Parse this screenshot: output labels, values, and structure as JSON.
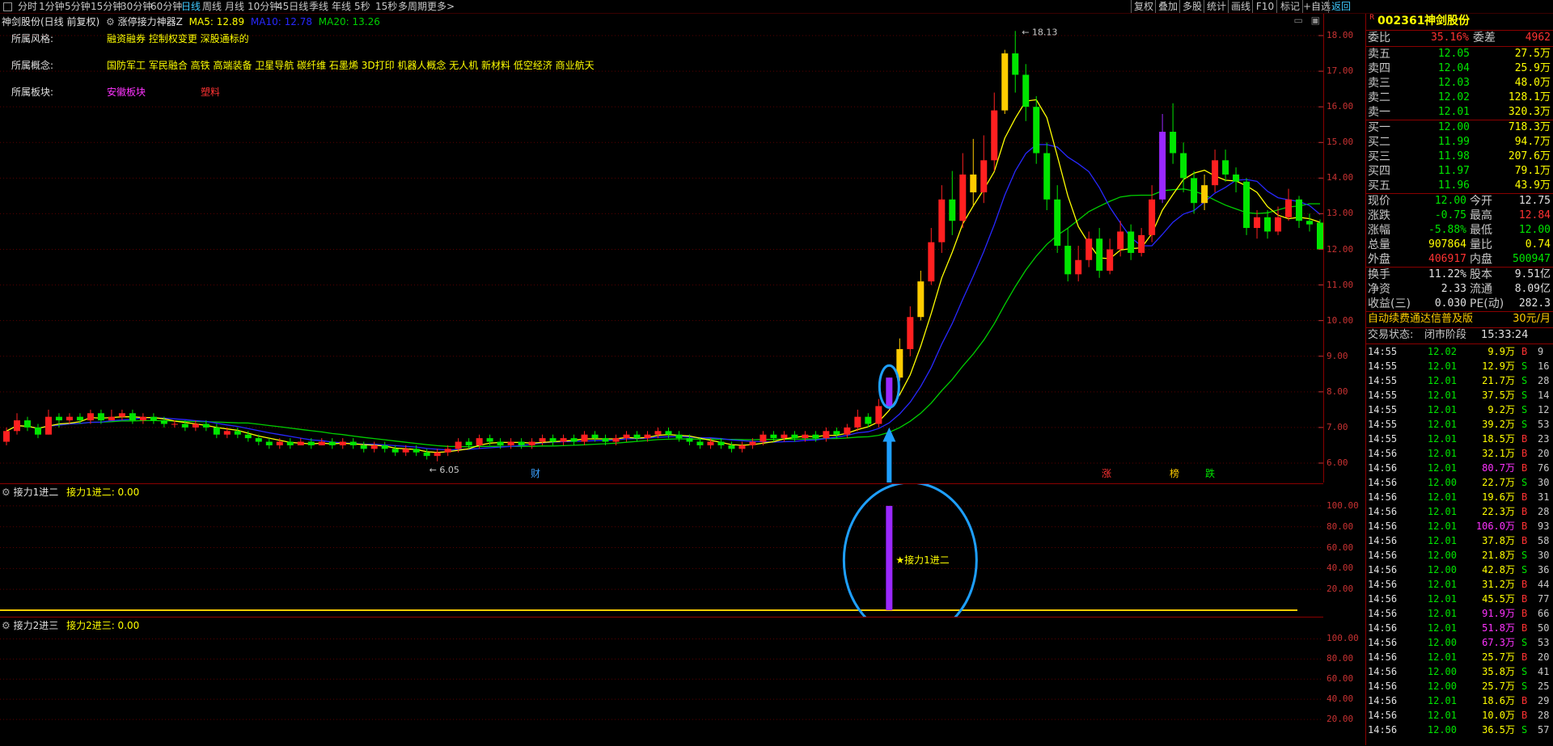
{
  "topbar": {
    "periods": [
      "分时",
      "1分钟",
      "5分钟",
      "15分钟",
      "30分钟",
      "60分钟",
      "日线",
      "周线",
      "月线",
      "10分钟",
      "45日线",
      "季线",
      "年线",
      "5秒",
      "15秒",
      "多周期",
      "更多>"
    ],
    "active_period": "日线",
    "tools": [
      "复权",
      "叠加",
      "多股",
      "统计",
      "画线",
      "F10",
      "标记",
      "+自选",
      "返回"
    ]
  },
  "chart_header": {
    "stock": "神剑股份(日线 前复权)",
    "indicator": "涨停接力神器Z",
    "ma5": "MA5: 12.89",
    "ma10": "MA10: 12.78",
    "ma20": "MA20: 13.26",
    "colors": {
      "ma5": "#ffff00",
      "ma10": "#2828ff",
      "ma20": "#00d000"
    }
  },
  "info": [
    {
      "label": "所属风格:",
      "value": "融资融券 控制权变更 深股通标的",
      "color": "#ffff00"
    },
    {
      "label": "所属概念:",
      "value": "国防军工 军民融合 高铁 高端装备 卫星导航 碳纤维 石墨烯 3D打印 机器人概念 无人机 新材料 低空经济 商业航天",
      "color": "#ffff00"
    },
    {
      "label": "所属板块:",
      "value": "安徽板块",
      "value2": "塑料",
      "color": "#ff33ff",
      "color2": "#ff3333"
    }
  ],
  "y_axis_main": [
    "18.00",
    "17.00",
    "16.00",
    "15.00",
    "14.00",
    "13.00",
    "12.00",
    "11.00",
    "10.00",
    "9.00",
    "8.00",
    "7.00",
    "6.00"
  ],
  "markers": {
    "high": "18.13",
    "low": "6.05",
    "cai": "财",
    "zhang": "涨",
    "bang": "榜",
    "die": "跌"
  },
  "indicator1": {
    "title": "接力1进二",
    "value_label": "接力1进二: 0.00",
    "signal_label": "★接力1进二",
    "y_axis": [
      "100.00",
      "80.00",
      "60.00",
      "40.00",
      "20.00"
    ]
  },
  "indicator2": {
    "title": "接力2进三",
    "value_label": "接力2进三: 0.00",
    "y_axis": [
      "100.00",
      "80.00",
      "60.00",
      "40.00",
      "20.00"
    ]
  },
  "quote": {
    "code": "002361",
    "name": "神剑股份",
    "weibi_label": "委比",
    "weibi": "35.16%",
    "weicha_label": "委差",
    "weicha": "4962",
    "asks": [
      {
        "label": "卖五",
        "price": "12.05",
        "vol": "27.5万"
      },
      {
        "label": "卖四",
        "price": "12.04",
        "vol": "25.9万"
      },
      {
        "label": "卖三",
        "price": "12.03",
        "vol": "48.0万"
      },
      {
        "label": "卖二",
        "price": "12.02",
        "vol": "128.1万"
      },
      {
        "label": "卖一",
        "price": "12.01",
        "vol": "320.3万"
      }
    ],
    "bids": [
      {
        "label": "买一",
        "price": "12.00",
        "vol": "718.3万"
      },
      {
        "label": "买二",
        "price": "11.99",
        "vol": "94.7万"
      },
      {
        "label": "买三",
        "price": "11.98",
        "vol": "207.6万"
      },
      {
        "label": "买四",
        "price": "11.97",
        "vol": "79.1万"
      },
      {
        "label": "买五",
        "price": "11.96",
        "vol": "43.9万"
      }
    ],
    "stats": [
      {
        "l1": "现价",
        "v1": "12.00",
        "c1": "#00e600",
        "l2": "今开",
        "v2": "12.75",
        "c2": "#e0e0e0"
      },
      {
        "l1": "涨跌",
        "v1": "-0.75",
        "c1": "#00e600",
        "l2": "最高",
        "v2": "12.84",
        "c2": "#ff3232"
      },
      {
        "l1": "涨幅",
        "v1": "-5.88%",
        "c1": "#00e600",
        "l2": "最低",
        "v2": "12.00",
        "c2": "#00e600"
      },
      {
        "l1": "总量",
        "v1": "907864",
        "c1": "#ffff00",
        "l2": "量比",
        "v2": "0.74",
        "c2": "#ffff00"
      },
      {
        "l1": "外盘",
        "v1": "406917",
        "c1": "#ff3232",
        "l2": "内盘",
        "v2": "500947",
        "c2": "#00e600"
      }
    ],
    "stats2": [
      {
        "l1": "换手",
        "v1": "11.22%",
        "l2": "股本",
        "v2": "9.51亿"
      },
      {
        "l1": "净资",
        "v1": "2.33",
        "l2": "流通",
        "v2": "8.09亿"
      },
      {
        "l1": "收益(三)",
        "v1": "0.030",
        "l2": "PE(动)",
        "v2": "282.3"
      }
    ],
    "ad": "自动续费通达信普及版",
    "ad_price": "30元/月",
    "trade_status_label": "交易状态:",
    "trade_status": "闭市阶段",
    "trade_time": "15:33:24",
    "ticks": [
      {
        "t": "14:55",
        "p": "12.02",
        "v": "9.9万",
        "bs": "B",
        "n": "9"
      },
      {
        "t": "14:55",
        "p": "12.01",
        "v": "12.9万",
        "bs": "S",
        "n": "16"
      },
      {
        "t": "14:55",
        "p": "12.01",
        "v": "21.7万",
        "bs": "S",
        "n": "28"
      },
      {
        "t": "14:55",
        "p": "12.01",
        "v": "37.5万",
        "bs": "S",
        "n": "14"
      },
      {
        "t": "14:55",
        "p": "12.01",
        "v": "9.2万",
        "bs": "S",
        "n": "12"
      },
      {
        "t": "14:55",
        "p": "12.01",
        "v": "39.2万",
        "bs": "S",
        "n": "53"
      },
      {
        "t": "14:55",
        "p": "12.01",
        "v": "18.5万",
        "bs": "B",
        "n": "23"
      },
      {
        "t": "14:56",
        "p": "12.01",
        "v": "32.1万",
        "bs": "B",
        "n": "20"
      },
      {
        "t": "14:56",
        "p": "12.01",
        "v": "80.7万",
        "bs": "B",
        "n": "76"
      },
      {
        "t": "14:56",
        "p": "12.00",
        "v": "22.7万",
        "bs": "S",
        "n": "30"
      },
      {
        "t": "14:56",
        "p": "12.01",
        "v": "19.6万",
        "bs": "B",
        "n": "31"
      },
      {
        "t": "14:56",
        "p": "12.01",
        "v": "22.3万",
        "bs": "B",
        "n": "28"
      },
      {
        "t": "14:56",
        "p": "12.01",
        "v": "106.0万",
        "bs": "B",
        "n": "93"
      },
      {
        "t": "14:56",
        "p": "12.01",
        "v": "37.8万",
        "bs": "B",
        "n": "58"
      },
      {
        "t": "14:56",
        "p": "12.00",
        "v": "21.8万",
        "bs": "S",
        "n": "30"
      },
      {
        "t": "14:56",
        "p": "12.00",
        "v": "42.8万",
        "bs": "S",
        "n": "36"
      },
      {
        "t": "14:56",
        "p": "12.01",
        "v": "31.2万",
        "bs": "B",
        "n": "44"
      },
      {
        "t": "14:56",
        "p": "12.01",
        "v": "45.5万",
        "bs": "B",
        "n": "77"
      },
      {
        "t": "14:56",
        "p": "12.01",
        "v": "91.9万",
        "bs": "B",
        "n": "66"
      },
      {
        "t": "14:56",
        "p": "12.01",
        "v": "51.8万",
        "bs": "B",
        "n": "50"
      },
      {
        "t": "14:56",
        "p": "12.00",
        "v": "67.3万",
        "bs": "S",
        "n": "53"
      },
      {
        "t": "14:56",
        "p": "12.01",
        "v": "25.7万",
        "bs": "B",
        "n": "20"
      },
      {
        "t": "14:56",
        "p": "12.00",
        "v": "35.8万",
        "bs": "S",
        "n": "41"
      },
      {
        "t": "14:56",
        "p": "12.00",
        "v": "25.7万",
        "bs": "S",
        "n": "25"
      },
      {
        "t": "14:56",
        "p": "12.01",
        "v": "18.6万",
        "bs": "B",
        "n": "29"
      },
      {
        "t": "14:56",
        "p": "12.01",
        "v": "10.0万",
        "bs": "B",
        "n": "28"
      },
      {
        "t": "14:56",
        "p": "12.00",
        "v": "36.5万",
        "bs": "S",
        "n": "57"
      }
    ]
  },
  "chart_data": {
    "type": "candlestick",
    "ylim": [
      5.5,
      18.5
    ],
    "candles": [
      [
        6.6,
        6.9,
        7.0,
        6.5
      ],
      [
        6.9,
        7.2,
        7.4,
        6.8
      ],
      [
        7.2,
        7.0,
        7.3,
        6.9
      ],
      [
        7.0,
        6.8,
        7.1,
        6.7
      ],
      [
        6.8,
        7.3,
        7.5,
        6.8
      ],
      [
        7.3,
        7.2,
        7.4,
        7.0
      ],
      [
        7.2,
        7.3,
        7.4,
        7.1
      ],
      [
        7.3,
        7.2,
        7.4,
        7.1
      ],
      [
        7.2,
        7.4,
        7.5,
        7.1
      ],
      [
        7.4,
        7.2,
        7.5,
        7.1
      ],
      [
        7.2,
        7.3,
        7.5,
        7.2
      ],
      [
        7.3,
        7.4,
        7.5,
        7.2
      ],
      [
        7.4,
        7.2,
        7.5,
        7.1
      ],
      [
        7.2,
        7.3,
        7.4,
        7.1
      ],
      [
        7.3,
        7.2,
        7.4,
        7.1
      ],
      [
        7.2,
        7.1,
        7.3,
        7.0
      ],
      [
        7.1,
        7.1,
        7.2,
        7.0
      ],
      [
        7.1,
        7.0,
        7.2,
        6.9
      ],
      [
        7.0,
        7.1,
        7.2,
        6.9
      ],
      [
        7.1,
        7.0,
        7.2,
        6.9
      ],
      [
        7.0,
        6.8,
        7.1,
        6.7
      ],
      [
        6.8,
        6.9,
        7.0,
        6.7
      ],
      [
        6.9,
        6.8,
        7.0,
        6.7
      ],
      [
        6.8,
        6.7,
        6.9,
        6.6
      ],
      [
        6.7,
        6.6,
        6.8,
        6.5
      ],
      [
        6.6,
        6.5,
        6.7,
        6.4
      ],
      [
        6.5,
        6.6,
        6.7,
        6.4
      ],
      [
        6.6,
        6.5,
        6.7,
        6.4
      ],
      [
        6.5,
        6.6,
        6.7,
        6.5
      ],
      [
        6.6,
        6.5,
        6.7,
        6.4
      ],
      [
        6.5,
        6.6,
        6.7,
        6.5
      ],
      [
        6.6,
        6.5,
        6.7,
        6.4
      ],
      [
        6.5,
        6.6,
        6.7,
        6.4
      ],
      [
        6.6,
        6.5,
        6.7,
        6.4
      ],
      [
        6.5,
        6.4,
        6.6,
        6.3
      ],
      [
        6.4,
        6.5,
        6.6,
        6.3
      ],
      [
        6.5,
        6.4,
        6.6,
        6.3
      ],
      [
        6.4,
        6.3,
        6.5,
        6.2
      ],
      [
        6.3,
        6.4,
        6.5,
        6.2
      ],
      [
        6.4,
        6.3,
        6.5,
        6.2
      ],
      [
        6.3,
        6.2,
        6.4,
        6.1
      ],
      [
        6.2,
        6.3,
        6.4,
        6.05
      ],
      [
        6.3,
        6.4,
        6.5,
        6.2
      ],
      [
        6.4,
        6.6,
        6.7,
        6.3
      ],
      [
        6.6,
        6.5,
        6.7,
        6.4
      ],
      [
        6.5,
        6.7,
        6.8,
        6.4
      ],
      [
        6.7,
        6.6,
        6.8,
        6.5
      ],
      [
        6.6,
        6.5,
        6.7,
        6.4
      ],
      [
        6.5,
        6.6,
        6.7,
        6.4
      ],
      [
        6.6,
        6.5,
        6.7,
        6.4
      ],
      [
        6.5,
        6.6,
        6.7,
        6.4
      ],
      [
        6.6,
        6.7,
        6.8,
        6.5
      ],
      [
        6.7,
        6.6,
        6.8,
        6.5
      ],
      [
        6.6,
        6.7,
        6.8,
        6.5
      ],
      [
        6.7,
        6.6,
        6.8,
        6.5
      ],
      [
        6.6,
        6.8,
        6.9,
        6.5
      ],
      [
        6.8,
        6.7,
        6.9,
        6.6
      ],
      [
        6.7,
        6.6,
        6.8,
        6.5
      ],
      [
        6.6,
        6.7,
        6.8,
        6.5
      ],
      [
        6.7,
        6.8,
        6.9,
        6.6
      ],
      [
        6.8,
        6.7,
        6.9,
        6.6
      ],
      [
        6.7,
        6.8,
        6.9,
        6.6
      ],
      [
        6.8,
        6.9,
        7.0,
        6.7
      ],
      [
        6.9,
        6.8,
        7.0,
        6.7
      ],
      [
        6.8,
        6.7,
        6.9,
        6.6
      ],
      [
        6.7,
        6.6,
        6.8,
        6.5
      ],
      [
        6.6,
        6.5,
        6.7,
        6.4
      ],
      [
        6.5,
        6.6,
        6.7,
        6.4
      ],
      [
        6.6,
        6.5,
        6.7,
        6.4
      ],
      [
        6.5,
        6.4,
        6.6,
        6.3
      ],
      [
        6.4,
        6.5,
        6.6,
        6.3
      ],
      [
        6.5,
        6.6,
        6.7,
        6.4
      ],
      [
        6.6,
        6.8,
        6.9,
        6.5
      ],
      [
        6.8,
        6.7,
        6.9,
        6.6
      ],
      [
        6.7,
        6.8,
        6.9,
        6.6
      ],
      [
        6.8,
        6.7,
        6.9,
        6.6
      ],
      [
        6.7,
        6.8,
        6.9,
        6.6
      ],
      [
        6.8,
        6.7,
        6.9,
        6.6
      ],
      [
        6.7,
        6.9,
        7.0,
        6.6
      ],
      [
        6.9,
        6.8,
        7.0,
        6.7
      ],
      [
        6.8,
        7.0,
        7.1,
        6.7
      ],
      [
        7.0,
        7.3,
        7.5,
        6.9
      ],
      [
        7.3,
        7.1,
        7.4,
        7.0
      ],
      [
        7.1,
        7.6,
        7.8,
        7.0
      ],
      [
        7.6,
        8.4,
        8.4,
        7.5
      ],
      [
        8.4,
        9.2,
        9.5,
        8.3
      ],
      [
        9.2,
        10.1,
        10.4,
        9.0
      ],
      [
        10.1,
        11.1,
        11.4,
        10.0
      ],
      [
        11.1,
        12.2,
        12.6,
        11.0
      ],
      [
        12.2,
        13.4,
        13.8,
        11.9
      ],
      [
        13.4,
        12.8,
        14.2,
        12.4
      ],
      [
        12.8,
        14.1,
        14.7,
        12.6
      ],
      [
        14.1,
        13.6,
        15.1,
        13.2
      ],
      [
        13.6,
        14.5,
        15.2,
        13.3
      ],
      [
        14.5,
        15.9,
        16.4,
        14.2
      ],
      [
        15.9,
        17.5,
        17.6,
        15.8
      ],
      [
        17.5,
        16.9,
        18.13,
        16.4
      ],
      [
        16.9,
        16.0,
        17.2,
        15.6
      ],
      [
        16.0,
        14.7,
        16.3,
        14.4
      ],
      [
        14.7,
        13.4,
        15.0,
        13.1
      ],
      [
        13.4,
        12.1,
        13.8,
        11.9
      ],
      [
        12.1,
        11.3,
        12.6,
        11.1
      ],
      [
        11.3,
        11.7,
        12.1,
        11.1
      ],
      [
        11.7,
        12.3,
        12.5,
        11.5
      ],
      [
        12.3,
        11.4,
        12.6,
        11.2
      ],
      [
        11.4,
        12.0,
        12.3,
        11.3
      ],
      [
        12.0,
        12.5,
        12.8,
        11.8
      ],
      [
        12.5,
        11.9,
        12.7,
        11.7
      ],
      [
        11.9,
        12.4,
        12.6,
        11.8
      ],
      [
        12.4,
        13.4,
        13.8,
        12.2
      ],
      [
        13.4,
        15.3,
        15.8,
        13.3
      ],
      [
        15.3,
        14.7,
        16.1,
        14.4
      ],
      [
        14.7,
        14.0,
        15.0,
        13.6
      ],
      [
        14.0,
        13.3,
        14.2,
        13.0
      ],
      [
        13.3,
        13.8,
        14.1,
        13.1
      ],
      [
        13.8,
        14.5,
        14.8,
        13.6
      ],
      [
        14.5,
        14.1,
        14.8,
        13.9
      ],
      [
        14.1,
        13.9,
        14.3,
        13.6
      ],
      [
        13.9,
        12.6,
        14.0,
        12.4
      ],
      [
        12.6,
        12.9,
        13.1,
        12.3
      ],
      [
        12.9,
        12.5,
        13.1,
        12.3
      ],
      [
        12.5,
        12.9,
        13.2,
        12.4
      ],
      [
        12.9,
        13.4,
        13.7,
        12.8
      ],
      [
        13.4,
        12.8,
        13.5,
        12.6
      ],
      [
        12.8,
        12.7,
        13.0,
        12.5
      ],
      [
        12.75,
        12.0,
        12.84,
        12.0
      ]
    ]
  }
}
